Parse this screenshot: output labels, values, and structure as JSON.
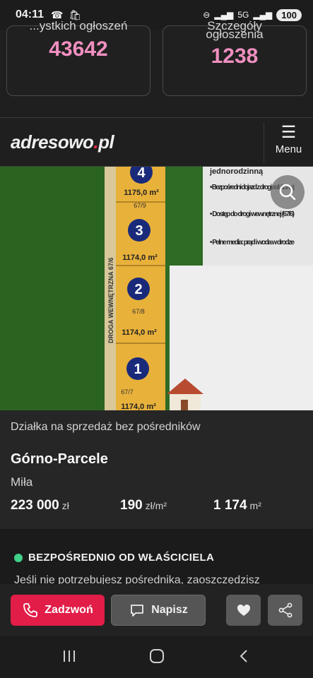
{
  "status": {
    "time": "04:11",
    "network": "5G",
    "battery": "100"
  },
  "stats": [
    {
      "label": "...ystkich ogłoszeń",
      "value": "43642"
    },
    {
      "label": "Szczegóły",
      "label2": "ogłoszenia",
      "value": "1238"
    }
  ],
  "header": {
    "logo_main": "adresowo",
    "logo_dot": ".",
    "logo_tld": "pl",
    "menu_label": "Menu"
  },
  "photo": {
    "road": "DROGA WEWNĘTRZNA 67/6",
    "plots": [
      {
        "number": "4",
        "area": "1175,0 m²",
        "id": "67/9"
      },
      {
        "number": "3",
        "area": "1174,0 m²",
        "id": "67/8"
      },
      {
        "number": "2",
        "area": "1174,0 m²",
        "id": "67/7"
      },
      {
        "number": "1",
        "area": "1174,0 m²",
        "id": ""
      }
    ],
    "notes": [
      "jednorodzinną",
      "• Bezpośredni dojazd z drogi asfaltowej",
      "• Dostęp do drogi wewnętrznej (67/6)",
      "• Pełne media: prąd i woda w drodze"
    ]
  },
  "listing": {
    "category": "Działka na sprzedaż bez pośredników",
    "title": "Górno-Parcele",
    "location": "Miła",
    "price": "223 000",
    "price_unit": "zł",
    "price_per_m": "190",
    "price_per_m_unit": "zł/m²",
    "area": "1 174",
    "area_unit": "m²"
  },
  "owner": {
    "badge": "BEZPOŚREDNIO OD WŁAŚCICIELA",
    "desc": "Jeśli nie potrzebujesz pośrednika, zaoszczędzisz"
  },
  "actions": {
    "call": "Zadzwoń",
    "write": "Napisz"
  }
}
